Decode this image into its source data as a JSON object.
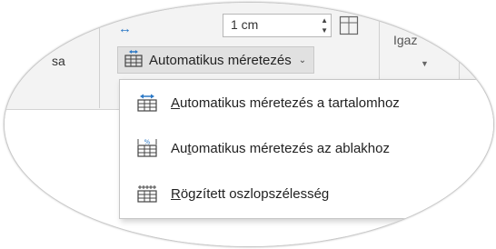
{
  "ribbon": {
    "partial_left_label": "sa",
    "width_value": "1 cm",
    "partial_right_label": "Igaz",
    "autofit_button": {
      "label": "Automatikus méretezés",
      "icon": "autofit-table-icon",
      "caret": "chevron-down-icon"
    }
  },
  "menu": {
    "items": [
      {
        "mnemonic": "A",
        "rest": "utomatikus méretezés a tartalomhoz",
        "icon": "autofit-contents-icon"
      },
      {
        "pre": "Au",
        "mnemonic": "t",
        "rest": "omatikus méretezés az ablakhoz",
        "icon": "autofit-window-icon"
      },
      {
        "mnemonic": "R",
        "rest": "ögzített oszlopszélesség",
        "icon": "fixed-column-width-icon"
      }
    ]
  },
  "colors": {
    "accent_blue": "#2b78c6",
    "ribbon_bg": "#f3f3f3",
    "button_hover": "#e1e1e1",
    "menu_bg": "#ffffff"
  }
}
